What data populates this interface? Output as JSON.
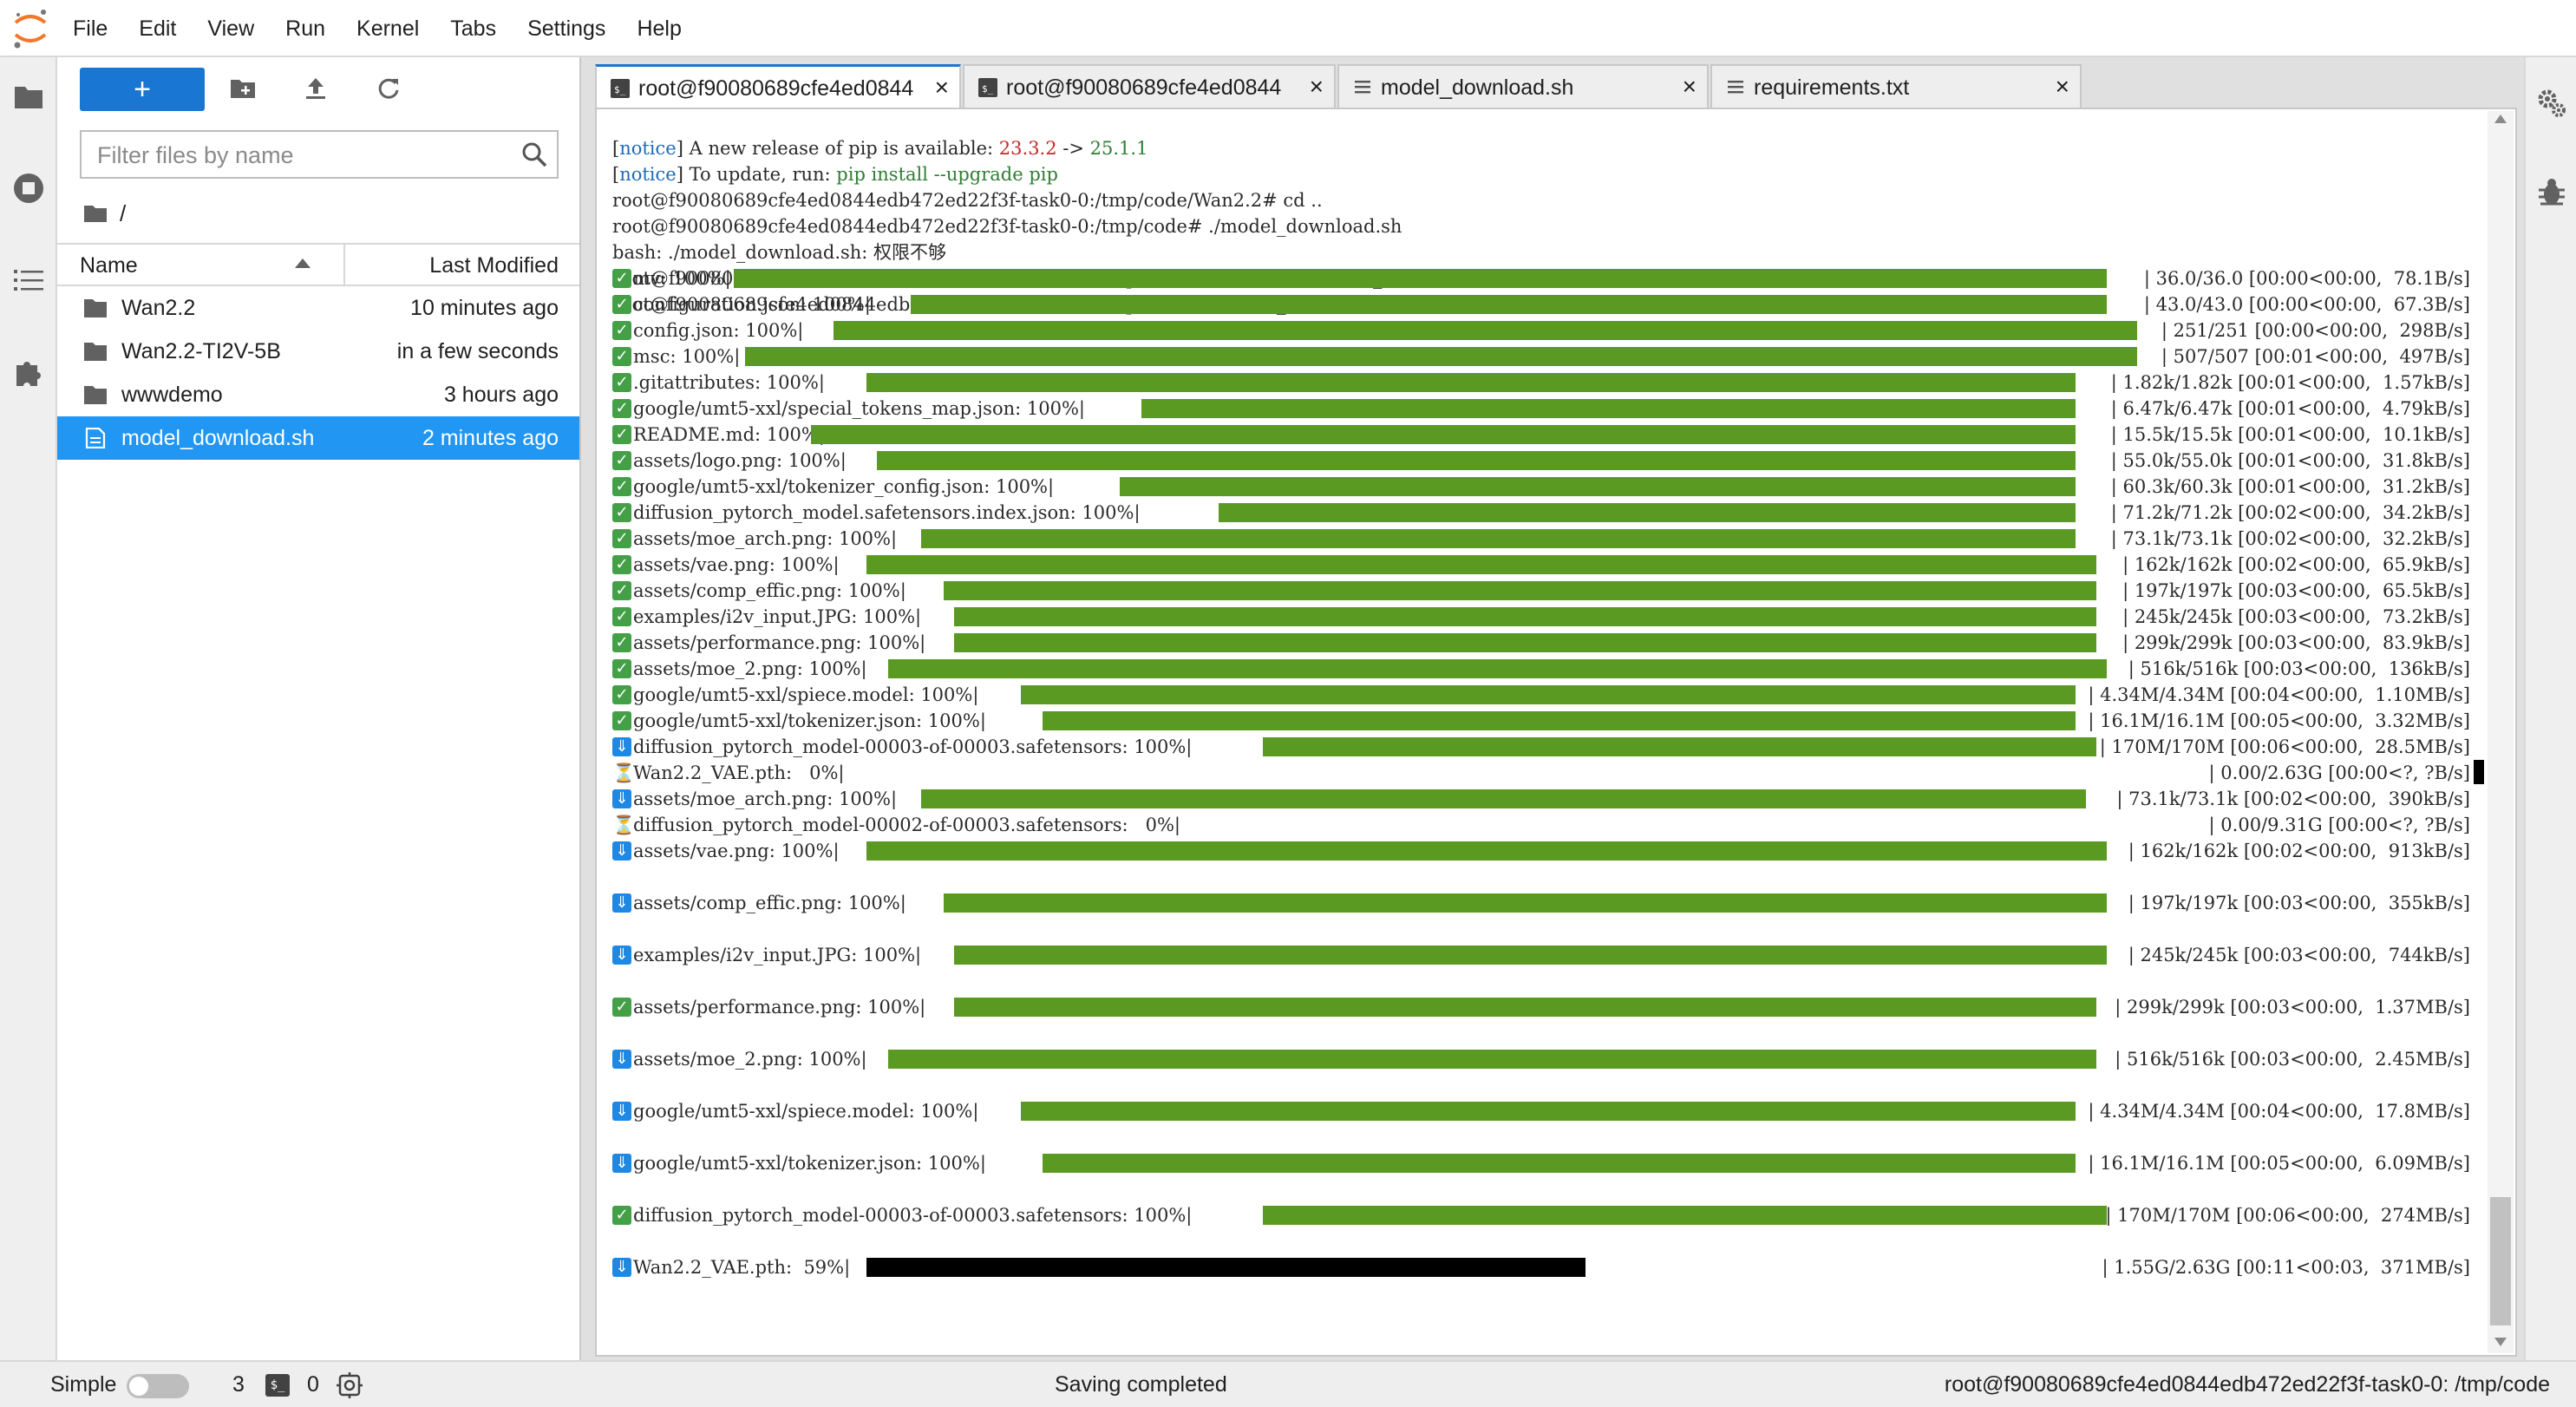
{
  "menu": [
    "File",
    "Edit",
    "View",
    "Run",
    "Kernel",
    "Tabs",
    "Settings",
    "Help"
  ],
  "file_browser": {
    "new_button_label": "+",
    "filter_placeholder": "Filter files by name",
    "breadcrumb": "/",
    "columns": {
      "name": "Name",
      "modified": "Last Modified"
    },
    "items": [
      {
        "name": "Wan2.2",
        "modified": "10 minutes ago",
        "type": "folder"
      },
      {
        "name": "Wan2.2-TI2V-5B",
        "modified": "in a few seconds",
        "type": "folder"
      },
      {
        "name": "wwwdemo",
        "modified": "3 hours ago",
        "type": "folder"
      },
      {
        "name": "model_download.sh",
        "modified": "2 minutes ago",
        "type": "file",
        "selected": true
      }
    ]
  },
  "tabs": [
    {
      "label": "root@f90080689cfe4ed0844",
      "type": "terminal",
      "active": true
    },
    {
      "label": "root@f90080689cfe4ed0844",
      "type": "terminal",
      "active": false
    },
    {
      "label": "model_download.sh",
      "type": "text",
      "active": false
    },
    {
      "label": "requirements.txt",
      "type": "text",
      "active": false
    }
  ],
  "close_glyph": "×",
  "terminal": {
    "notice_tag": "notice",
    "notice1_text": " A new release of pip is available: ",
    "pip_old": "23.3.2",
    "arrow": " -> ",
    "pip_new": "25.1.1",
    "notice2_text": " To update, run: ",
    "pip_cmd": "pip install --upgrade pip",
    "lines": [
      "root@f90080689cfe4ed0844edb472ed22f3f-task0-0:/tmp/code/Wan2.2# cd ..",
      "root@f90080689cfe4ed0844edb472ed22f3f-task0-0:/tmp/code# ./model_download.sh",
      "bash: ./model_download.sh: 权限不够",
      "root@f90080689cfe4ed0844edb472ed22f3f-task0-0:/tmp/code# chmod 755 model_download.sh",
      "root@f90080689cfe4ed0844edb472ed22f3f-task0-0:/tmp/code# ./model_download.sh"
    ],
    "progress": [
      {
        "row": 7,
        "status": "done",
        "label": "mv: 100%|",
        "fill": 1,
        "stat": "| 36.0/36.0 [00:00<00:00,  78.1B/s]"
      },
      {
        "row": 8,
        "status": "done",
        "label": "configuration.json: 100%|",
        "fill": 1,
        "stat": "| 43.0/43.0 [00:00<00:00,  67.3B/s]"
      },
      {
        "row": 9,
        "status": "done",
        "label": "config.json: 100%|",
        "fill": 1,
        "stat": "| 251/251 [00:00<00:00,  298B/s]"
      },
      {
        "row": 10,
        "status": "done",
        "label": "msc: 100%|",
        "fill": 1,
        "stat": "| 507/507 [00:01<00:00,  497B/s]"
      },
      {
        "row": 11,
        "status": "done",
        "label": ".gitattributes: 100%|",
        "fill": 1,
        "stat": "| 1.82k/1.82k [00:01<00:00,  1.57kB/s]"
      },
      {
        "row": 12,
        "status": "done",
        "label": "google/umt5-xxl/special_tokens_map.json: 100%|",
        "fill": 1,
        "stat": "| 6.47k/6.47k [00:01<00:00,  4.79kB/s]"
      },
      {
        "row": 13,
        "status": "done",
        "label": "README.md: 100%|",
        "fill": 1,
        "stat": "| 15.5k/15.5k [00:01<00:00,  10.1kB/s]"
      },
      {
        "row": 14,
        "status": "done",
        "label": "assets/logo.png: 100%|",
        "fill": 1,
        "stat": "| 55.0k/55.0k [00:01<00:00,  31.8kB/s]"
      },
      {
        "row": 15,
        "status": "done",
        "label": "google/umt5-xxl/tokenizer_config.json: 100%|",
        "fill": 1,
        "stat": "| 60.3k/60.3k [00:01<00:00,  31.2kB/s]"
      },
      {
        "row": 16,
        "status": "done",
        "label": "diffusion_pytorch_model.safetensors.index.json: 100%|",
        "fill": 1,
        "stat": "| 71.2k/71.2k [00:02<00:00,  34.2kB/s]"
      },
      {
        "row": 17,
        "status": "done",
        "label": "assets/moe_arch.png: 100%|",
        "fill": 1,
        "stat": "| 73.1k/73.1k [00:02<00:00,  32.2kB/s]"
      },
      {
        "row": 18,
        "status": "done",
        "label": "assets/vae.png: 100%|",
        "fill": 1,
        "stat": "| 162k/162k [00:02<00:00,  65.9kB/s]"
      },
      {
        "row": 19,
        "status": "done",
        "label": "assets/comp_effic.png: 100%|",
        "fill": 1,
        "stat": "| 197k/197k [00:03<00:00,  65.5kB/s]"
      },
      {
        "row": 20,
        "status": "done",
        "label": "examples/i2v_input.JPG: 100%|",
        "fill": 1,
        "stat": "| 245k/245k [00:03<00:00,  73.2kB/s]"
      },
      {
        "row": 21,
        "status": "done",
        "label": "assets/performance.png: 100%|",
        "fill": 1,
        "stat": "| 299k/299k [00:03<00:00,  83.9kB/s]"
      },
      {
        "row": 22,
        "status": "done",
        "label": "assets/moe_2.png: 100%|",
        "fill": 1,
        "stat": "| 516k/516k [00:03<00:00,  136kB/s]"
      },
      {
        "row": 23,
        "status": "done",
        "label": "google/umt5-xxl/spiece.model: 100%|",
        "fill": 1,
        "stat": "| 4.34M/4.34M [00:04<00:00,  1.10MB/s]"
      },
      {
        "row": 24,
        "status": "done",
        "label": "google/umt5-xxl/tokenizer.json: 100%|",
        "fill": 1,
        "stat": "| 16.1M/16.1M [00:05<00:00,  3.32MB/s]"
      },
      {
        "row": 25,
        "status": "dl",
        "label": "diffusion_pytorch_model-00003-of-00003.safetensors: 100%|",
        "fill": 1,
        "stat": "| 170M/170M [00:06<00:00,  28.5MB/s]"
      },
      {
        "row": 26,
        "status": "wait",
        "label": "Wan2.2_VAE.pth:   0%|",
        "fill": 0,
        "stat": "| 0.00/2.63G [00:00<?, ?B/s]"
      },
      {
        "row": 27,
        "status": "dl",
        "label": "assets/moe_arch.png: 100%|",
        "fill": 1,
        "stat": "| 73.1k/73.1k [00:02<00:00,  390kB/s]"
      },
      {
        "row": 28,
        "status": "wait",
        "label": "diffusion_pytorch_model-00002-of-00003.safetensors:   0%|",
        "fill": 0,
        "stat": "| 0.00/9.31G [00:00<?, ?B/s]"
      },
      {
        "row": 29,
        "status": "dl",
        "label": "assets/vae.png: 100%|",
        "fill": 1,
        "stat": "| 162k/162k [00:02<00:00,  913kB/s]"
      },
      {
        "row": 31,
        "status": "dl",
        "label": "assets/comp_effic.png: 100%|",
        "fill": 1,
        "stat": "| 197k/197k [00:03<00:00,  355kB/s]"
      },
      {
        "row": 33,
        "status": "dl",
        "label": "examples/i2v_input.JPG: 100%|",
        "fill": 1,
        "stat": "| 245k/245k [00:03<00:00,  744kB/s]"
      },
      {
        "row": 35,
        "status": "done",
        "label": "assets/performance.png: 100%|",
        "fill": 1,
        "stat": "| 299k/299k [00:03<00:00,  1.37MB/s]"
      },
      {
        "row": 37,
        "status": "dl",
        "label": "assets/moe_2.png: 100%|",
        "fill": 1,
        "stat": "| 516k/516k [00:03<00:00,  2.45MB/s]"
      },
      {
        "row": 39,
        "status": "dl",
        "label": "google/umt5-xxl/spiece.model: 100%|",
        "fill": 1,
        "stat": "| 4.34M/4.34M [00:04<00:00,  17.8MB/s]"
      },
      {
        "row": 41,
        "status": "dl",
        "label": "google/umt5-xxl/tokenizer.json: 100%|",
        "fill": 1,
        "stat": "| 16.1M/16.1M [00:05<00:00,  6.09MB/s]"
      },
      {
        "row": 43,
        "status": "done",
        "label": "diffusion_pytorch_model-00003-of-00003.safetensors: 100%|",
        "fill": 1,
        "stat": "| 170M/170M [00:06<00:00,  274MB/s]"
      },
      {
        "row": 45,
        "status": "dl",
        "label": "Wan2.2_VAE.pth:  59%|",
        "fill": 0.59,
        "stat": "| 1.55G/2.63G [00:11<00:03,  371MB/s]",
        "bar_color": "black"
      }
    ]
  },
  "statusbar": {
    "mode_label": "Simple",
    "terminal_count": "3",
    "terminal_icon_glyph": "$_",
    "kernel_count": "0",
    "message": "Saving completed",
    "path": "root@f90080689cfe4ed0844edb472ed22f3f-task0-0: /tmp/code"
  },
  "colors": {
    "accent": "#1976d2",
    "progress_green": "#5b9a22",
    "selection": "#2196f3"
  },
  "icons": [
    "jupyter-logo-icon",
    "folder-icon",
    "running-icon",
    "toc-icon",
    "extension-icon",
    "new-folder-icon",
    "upload-icon",
    "refresh-icon",
    "search-icon",
    "property-inspector-icon",
    "debugger-icon",
    "terminal-icon",
    "text-file-icon"
  ]
}
